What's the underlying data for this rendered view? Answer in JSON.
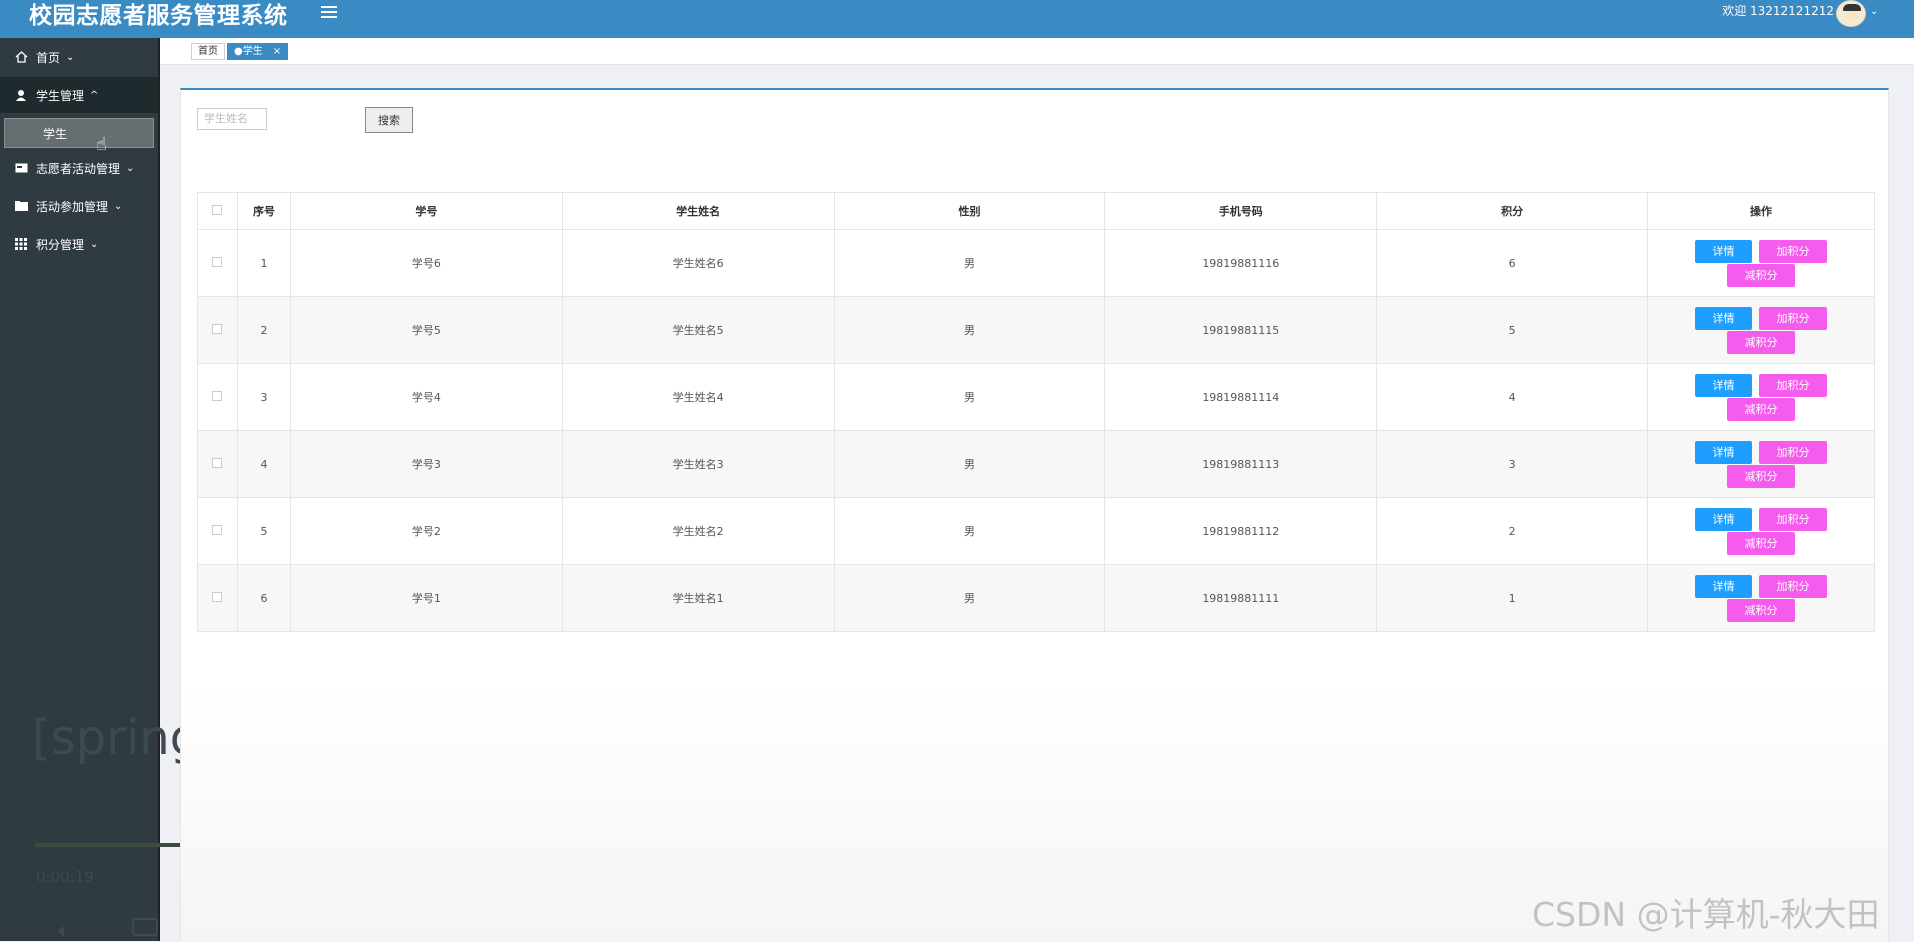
{
  "header": {
    "title": "校园志愿者服务管理系统",
    "welcome": "欢迎 13212121212"
  },
  "sidebar": {
    "items": [
      {
        "label": "首页",
        "icon": "home-icon"
      },
      {
        "label": "学生管理",
        "icon": "user-icon"
      },
      {
        "label": "志愿者活动管理",
        "icon": "card-icon"
      },
      {
        "label": "活动参加管理",
        "icon": "folder-icon"
      },
      {
        "label": "积分管理",
        "icon": "grid-icon"
      }
    ],
    "sub_item": "学生"
  },
  "video_overlay": {
    "title": "[spring",
    "time": "0:00:19"
  },
  "tabs": [
    {
      "label": "首页"
    },
    {
      "label": "●学生"
    }
  ],
  "search": {
    "placeholder": "学生姓名",
    "button": "搜索"
  },
  "table": {
    "headers": [
      "序号",
      "学号",
      "学生姓名",
      "性别",
      "手机号码",
      "积分",
      "操作"
    ],
    "rows": [
      {
        "idx": "1",
        "id": "学号6",
        "name": "学生姓名6",
        "gender": "男",
        "phone": "19819881116",
        "points": "6"
      },
      {
        "idx": "2",
        "id": "学号5",
        "name": "学生姓名5",
        "gender": "男",
        "phone": "19819881115",
        "points": "5"
      },
      {
        "idx": "3",
        "id": "学号4",
        "name": "学生姓名4",
        "gender": "男",
        "phone": "19819881114",
        "points": "4"
      },
      {
        "idx": "4",
        "id": "学号3",
        "name": "学生姓名3",
        "gender": "男",
        "phone": "19819881113",
        "points": "3"
      },
      {
        "idx": "5",
        "id": "学号2",
        "name": "学生姓名2",
        "gender": "男",
        "phone": "19819881112",
        "points": "2"
      },
      {
        "idx": "6",
        "id": "学号1",
        "name": "学生姓名1",
        "gender": "男",
        "phone": "19819881111",
        "points": "1"
      }
    ],
    "actions": {
      "detail": "详情",
      "add": "加积分",
      "sub": "减积分"
    }
  },
  "watermark": "CSDN @计算机-秋大田",
  "colors": {
    "header": "#3a8ac4",
    "sidebar": "#2f3b40",
    "detail": "#1e9fff",
    "points": "#f55ced"
  }
}
